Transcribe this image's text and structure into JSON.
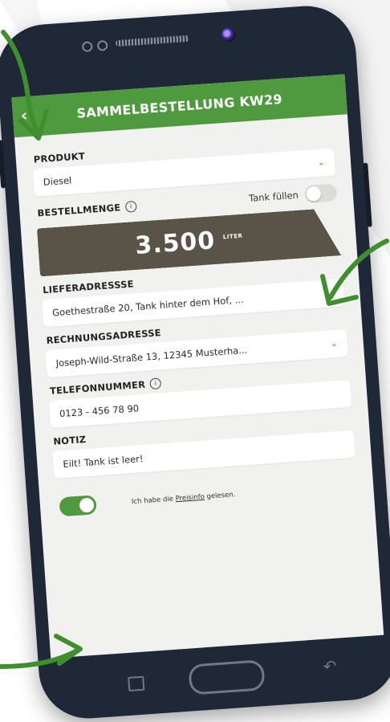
{
  "header": {
    "title": "SAMMELBESTELLUNG KW29",
    "back_icon": "chevron-left-icon"
  },
  "produkt": {
    "label": "PRODUKT",
    "value": "Diesel"
  },
  "bestellmenge": {
    "label": "BESTELLMENGE",
    "tank_fill_label": "Tank füllen",
    "tank_fill_on": false,
    "amount": "3.500",
    "unit": "LITER"
  },
  "lieferadresse": {
    "label": "LIEFERADRESSSE",
    "value": "Goethestraße 20, Tank hinter dem Hof, ..."
  },
  "rechnungsadresse": {
    "label": "RECHNUNGSADRESSE",
    "value": "Joseph-Wild-Straße 13, 12345 Musterha..."
  },
  "telefon": {
    "label": "TELEFONNUMMER",
    "value": "0123 - 456 78 90"
  },
  "notiz": {
    "label": "NOTIZ",
    "value": "Eilt! Tank ist leer!"
  },
  "consent": {
    "prefix": "Ich habe die",
    "link": "Preisinfo",
    "suffix": "gelesen.",
    "checked": true
  },
  "colors": {
    "accent": "#4f9a3e",
    "amount_bg": "#5a5347",
    "phone": "#1f2836"
  }
}
